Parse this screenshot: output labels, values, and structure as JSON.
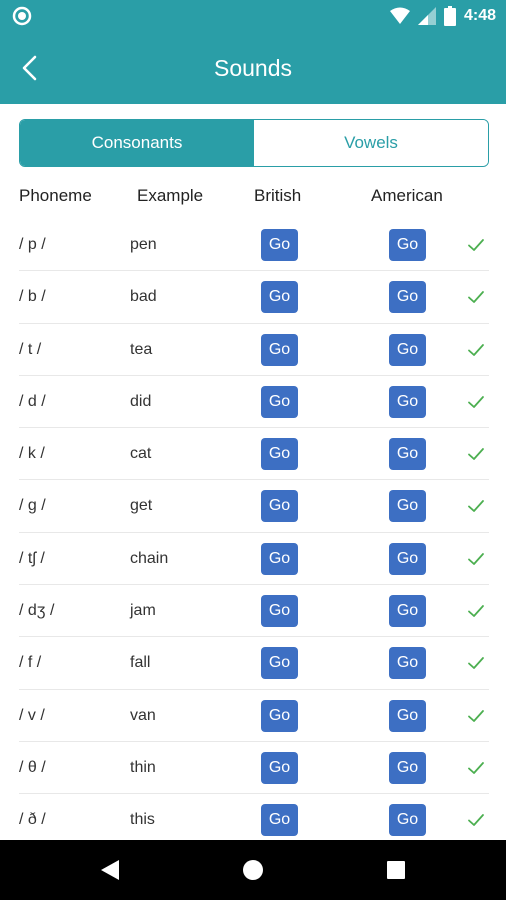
{
  "status": {
    "time": "4:48"
  },
  "header": {
    "title": "Sounds"
  },
  "tabs": [
    {
      "label": "Consonants",
      "active": true
    },
    {
      "label": "Vowels",
      "active": false
    }
  ],
  "columns": {
    "phoneme": "Phoneme",
    "example": "Example",
    "british": "British",
    "american": "American"
  },
  "go_label": "Go",
  "rows": [
    {
      "phoneme": "/ p /",
      "example": "pen"
    },
    {
      "phoneme": "/ b /",
      "example": "bad"
    },
    {
      "phoneme": "/ t /",
      "example": "tea"
    },
    {
      "phoneme": "/ d /",
      "example": "did"
    },
    {
      "phoneme": "/ k /",
      "example": "cat"
    },
    {
      "phoneme": "/ g /",
      "example": "get"
    },
    {
      "phoneme": "/ tʃ /",
      "example": "chain"
    },
    {
      "phoneme": "/ dʒ /",
      "example": "jam"
    },
    {
      "phoneme": "/ f /",
      "example": "fall"
    },
    {
      "phoneme": "/ v /",
      "example": "van"
    },
    {
      "phoneme": "/ θ /",
      "example": "thin"
    },
    {
      "phoneme": "/ ð /",
      "example": "this"
    }
  ],
  "colors": {
    "primary": "#2a9ea7",
    "button": "#3d6fc3",
    "check": "#4caf50"
  },
  "icons": {
    "back": "chevron-left-icon",
    "check": "check-icon"
  }
}
